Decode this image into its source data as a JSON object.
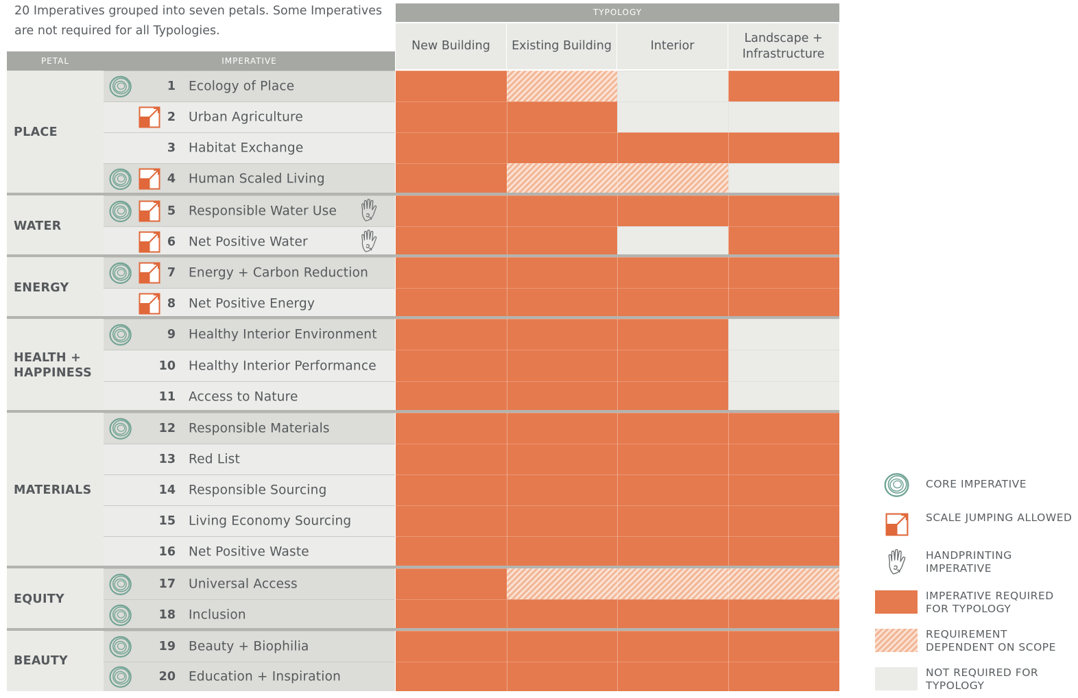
{
  "intro": "20 Imperatives grouped into seven petals. Some Imperatives are not required for all Typologies.",
  "headers": {
    "petal": "PETAL",
    "imperative": "IMPERATIVE",
    "typology": "TYPOLOGY"
  },
  "typologies": [
    "New Building",
    "Existing Building",
    "Interior",
    "Landscape + Infrastructure"
  ],
  "colors": {
    "required": "#e57a4e",
    "dependent": "#f2b797",
    "not_required": "#ebebe8",
    "core_icon": "#6fa394",
    "scale_icon": "#e0683a"
  },
  "petals": [
    {
      "name": "PLACE",
      "rows": [
        0,
        1,
        2,
        3
      ]
    },
    {
      "name": "WATER",
      "rows": [
        4,
        5
      ]
    },
    {
      "name": "ENERGY",
      "rows": [
        6,
        7
      ]
    },
    {
      "name": "HEALTH + HAPPINESS",
      "rows": [
        8,
        9,
        10
      ]
    },
    {
      "name": "MATERIALS",
      "rows": [
        11,
        12,
        13,
        14,
        15
      ]
    },
    {
      "name": "EQUITY",
      "rows": [
        16,
        17
      ]
    },
    {
      "name": "BEAUTY",
      "rows": [
        18,
        19
      ]
    }
  ],
  "imperatives": [
    {
      "num": "1",
      "name": "Ecology of Place",
      "core": true,
      "scale": false,
      "hand": false,
      "status": [
        "R",
        "D",
        "N",
        "R"
      ]
    },
    {
      "num": "2",
      "name": "Urban Agriculture",
      "core": false,
      "scale": true,
      "hand": false,
      "status": [
        "R",
        "R",
        "N",
        "N"
      ]
    },
    {
      "num": "3",
      "name": "Habitat Exchange",
      "core": false,
      "scale": false,
      "hand": false,
      "status": [
        "R",
        "R",
        "R",
        "R"
      ]
    },
    {
      "num": "4",
      "name": "Human Scaled Living",
      "core": true,
      "scale": true,
      "hand": false,
      "status": [
        "R",
        "D",
        "D",
        "N"
      ]
    },
    {
      "num": "5",
      "name": "Responsible Water Use",
      "core": true,
      "scale": true,
      "hand": true,
      "status": [
        "R",
        "R",
        "R",
        "R"
      ]
    },
    {
      "num": "6",
      "name": "Net Positive Water",
      "core": false,
      "scale": true,
      "hand": true,
      "status": [
        "R",
        "R",
        "N",
        "R"
      ]
    },
    {
      "num": "7",
      "name": "Energy + Carbon Reduction",
      "core": true,
      "scale": true,
      "hand": false,
      "status": [
        "R",
        "R",
        "R",
        "R"
      ]
    },
    {
      "num": "8",
      "name": "Net Positive Energy",
      "core": false,
      "scale": true,
      "hand": false,
      "status": [
        "R",
        "R",
        "R",
        "R"
      ]
    },
    {
      "num": "9",
      "name": "Healthy Interior Environment",
      "core": true,
      "scale": false,
      "hand": false,
      "status": [
        "R",
        "R",
        "R",
        "N"
      ]
    },
    {
      "num": "10",
      "name": "Healthy Interior Performance",
      "core": false,
      "scale": false,
      "hand": false,
      "status": [
        "R",
        "R",
        "R",
        "N"
      ]
    },
    {
      "num": "11",
      "name": "Access to Nature",
      "core": false,
      "scale": false,
      "hand": false,
      "status": [
        "R",
        "R",
        "R",
        "N"
      ]
    },
    {
      "num": "12",
      "name": "Responsible Materials",
      "core": true,
      "scale": false,
      "hand": false,
      "status": [
        "R",
        "R",
        "R",
        "R"
      ]
    },
    {
      "num": "13",
      "name": "Red List",
      "core": false,
      "scale": false,
      "hand": false,
      "status": [
        "R",
        "R",
        "R",
        "R"
      ]
    },
    {
      "num": "14",
      "name": "Responsible Sourcing",
      "core": false,
      "scale": false,
      "hand": false,
      "status": [
        "R",
        "R",
        "R",
        "R"
      ]
    },
    {
      "num": "15",
      "name": "Living Economy Sourcing",
      "core": false,
      "scale": false,
      "hand": false,
      "status": [
        "R",
        "R",
        "R",
        "R"
      ]
    },
    {
      "num": "16",
      "name": "Net Positive Waste",
      "core": false,
      "scale": false,
      "hand": false,
      "status": [
        "R",
        "R",
        "R",
        "R"
      ]
    },
    {
      "num": "17",
      "name": "Universal Access",
      "core": true,
      "scale": false,
      "hand": false,
      "status": [
        "R",
        "D",
        "D",
        "D"
      ]
    },
    {
      "num": "18",
      "name": "Inclusion",
      "core": true,
      "scale": false,
      "hand": false,
      "status": [
        "R",
        "R",
        "R",
        "R"
      ]
    },
    {
      "num": "19",
      "name": "Beauty + Biophilia",
      "core": true,
      "scale": false,
      "hand": false,
      "status": [
        "R",
        "R",
        "R",
        "R"
      ]
    },
    {
      "num": "20",
      "name": "Education + Inspiration",
      "core": true,
      "scale": false,
      "hand": false,
      "status": [
        "R",
        "R",
        "R",
        "R"
      ]
    }
  ],
  "legend": [
    {
      "key": "core",
      "label": "CORE IMPERATIVE",
      "icon": "core-imperative-icon"
    },
    {
      "key": "scale",
      "label": "SCALE JUMPING ALLOWED",
      "icon": "scale-jumping-icon"
    },
    {
      "key": "hand",
      "label": "HANDPRINTING IMPERATIVE",
      "icon": "handprint-icon"
    },
    {
      "key": "R",
      "label": "IMPERATIVE REQUIRED FOR TYPOLOGY"
    },
    {
      "key": "D",
      "label": "REQUIREMENT DEPENDENT ON SCOPE"
    },
    {
      "key": "N",
      "label": "NOT REQUIRED FOR TYPOLOGY"
    }
  ]
}
